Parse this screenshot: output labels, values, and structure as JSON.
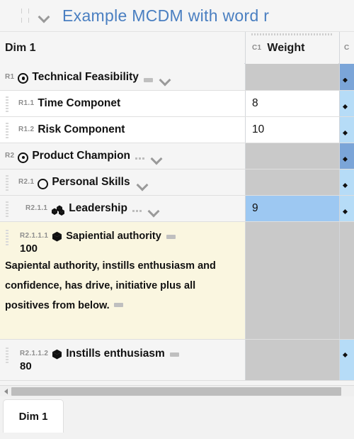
{
  "titlebar": {
    "title": "Example MCDM with word r",
    "chevron_icon": "chevron-down-icon",
    "grip_icon": "drag-grip-icon"
  },
  "columns": [
    {
      "code": "",
      "label": "Dim 1"
    },
    {
      "code": "C1",
      "label": "Weight"
    },
    {
      "code": "C",
      "label": ""
    }
  ],
  "rows": [
    {
      "code": "R1",
      "name": "Technical Feasibility",
      "icon": "target-icon",
      "level": 0,
      "trailing": "dash",
      "chevron": true,
      "weight": "",
      "weight_style": "grey",
      "c2_style": "blue",
      "c2_glyph": true,
      "row_style": "shade"
    },
    {
      "code": "R1.1",
      "name": "Time Componet",
      "icon": "none",
      "level": 1,
      "trailing": "none",
      "chevron": false,
      "weight": "8",
      "weight_style": "white",
      "c2_style": "lblue",
      "c2_glyph": true,
      "row_style": "plain"
    },
    {
      "code": "R1.2",
      "name": "Risk Component",
      "icon": "none",
      "level": 1,
      "trailing": "none",
      "chevron": false,
      "weight": "10",
      "weight_style": "white",
      "c2_style": "lblue",
      "c2_glyph": true,
      "row_style": "plain"
    },
    {
      "code": "R2",
      "name": "Product Champion",
      "icon": "target-icon",
      "level": 0,
      "trailing": "dots",
      "chevron": true,
      "weight": "",
      "weight_style": "grey",
      "c2_style": "blue",
      "c2_glyph": true,
      "row_style": "shade"
    },
    {
      "code": "R2.1",
      "name": "Personal Skills",
      "icon": "circle-icon",
      "level": 1,
      "trailing": "none",
      "chevron": true,
      "weight": "",
      "weight_style": "grey",
      "c2_style": "lblue",
      "c2_glyph": true,
      "row_style": "shade"
    },
    {
      "code": "R2.1.1",
      "name": "Leadership",
      "icon": "cubes-icon",
      "level": 2,
      "trailing": "dots",
      "chevron": true,
      "weight": "9",
      "weight_style": "sel",
      "c2_style": "lblue",
      "c2_glyph": true,
      "row_style": "shade",
      "burger": true
    }
  ],
  "note_row": {
    "code": "R2.1.1.1",
    "name": "Sapiential authority",
    "icon": "cube-icon",
    "trailing": "dash",
    "value": "100",
    "text": "Sapiental authority, instills enthusiasm and confidence, has drive, initiative plus all positives from below.",
    "weight": "",
    "weight_style": "grey",
    "c2_style": "grey",
    "c2_glyph": false
  },
  "last_row": {
    "code": "R2.1.1.2",
    "name": "Instills enthusiasm",
    "icon": "cube-icon",
    "trailing": "dash",
    "value": "80",
    "weight": "",
    "weight_style": "grey",
    "c2_style": "lblue",
    "c2_glyph": true
  },
  "scrollbar": {
    "left_arrow_icon": "scroll-left-arrow-icon"
  },
  "tabs": [
    {
      "label": "Dim 1",
      "active": true
    }
  ],
  "colors": {
    "title": "#4a7fc1",
    "cell_blue": "#7ba5d8",
    "cell_light_blue": "#b6dcf7",
    "cell_selected": "#9dc8f2",
    "cell_grey": "#c9c9c9",
    "note_bg": "#faf6e0"
  }
}
